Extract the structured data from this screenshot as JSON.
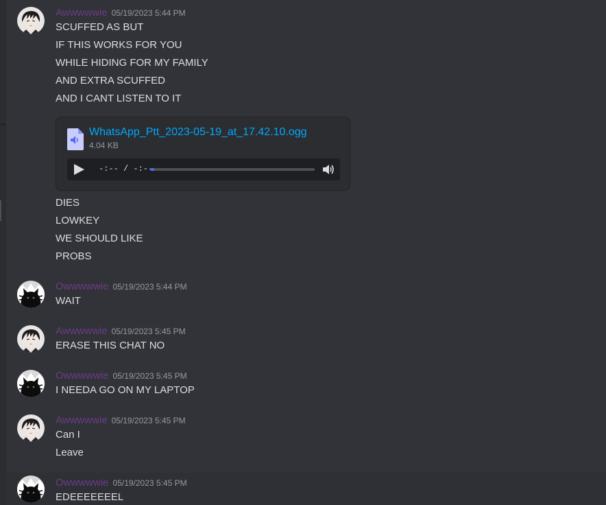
{
  "users": {
    "a": {
      "name": "Awwwwwie",
      "avatar_icon": "anime-boy-avatar-icon"
    },
    "o": {
      "name": "Owwwwwie",
      "avatar_icon": "black-cat-avatar-icon"
    }
  },
  "messages": [
    {
      "author": "Awwwwwie",
      "timestamp": "05/19/2023 5:44 PM",
      "lines_before": [
        "SCUFFED AS BUT",
        "IF THIS WORKS FOR YOU",
        "WHILE HIDING FOR MY FAMILY",
        "AND EXTRA SCUFFED",
        "AND I CANT LISTEN TO IT"
      ],
      "attachment": {
        "file_name": "WhatsApp_Ptt_2023-05-19_at_17.42.10.ogg",
        "file_size": "4.04 KB",
        "time": "-:-- / -:--",
        "progress": 0.02
      },
      "lines_after": [
        "DIES",
        "LOWKEY",
        "WE SHOULD LIKE",
        "PROBS"
      ]
    },
    {
      "author": "Owwwwwie",
      "timestamp": "05/19/2023 5:44 PM",
      "lines": [
        "WAIT"
      ]
    },
    {
      "author": "Awwwwwie",
      "timestamp": "05/19/2023 5:45 PM",
      "lines": [
        "ERASE THIS CHAT NO"
      ]
    },
    {
      "author": "Owwwwwie",
      "timestamp": "05/19/2023 5:45 PM",
      "lines": [
        "I NEEDA GO ON MY LAPTOP"
      ]
    },
    {
      "author": "Awwwwwie",
      "timestamp": "05/19/2023 5:45 PM",
      "lines": [
        "Can I",
        "Leave"
      ]
    },
    {
      "author": "Owwwwwie",
      "timestamp": "05/19/2023 5:45 PM",
      "lines": [
        "EDEEEEEEEL"
      ]
    }
  ],
  "colors": {
    "background": "#313338",
    "username": "#6a3d86",
    "link": "#00a8fc",
    "text": "#dbdee1",
    "muted": "#949ba4"
  }
}
